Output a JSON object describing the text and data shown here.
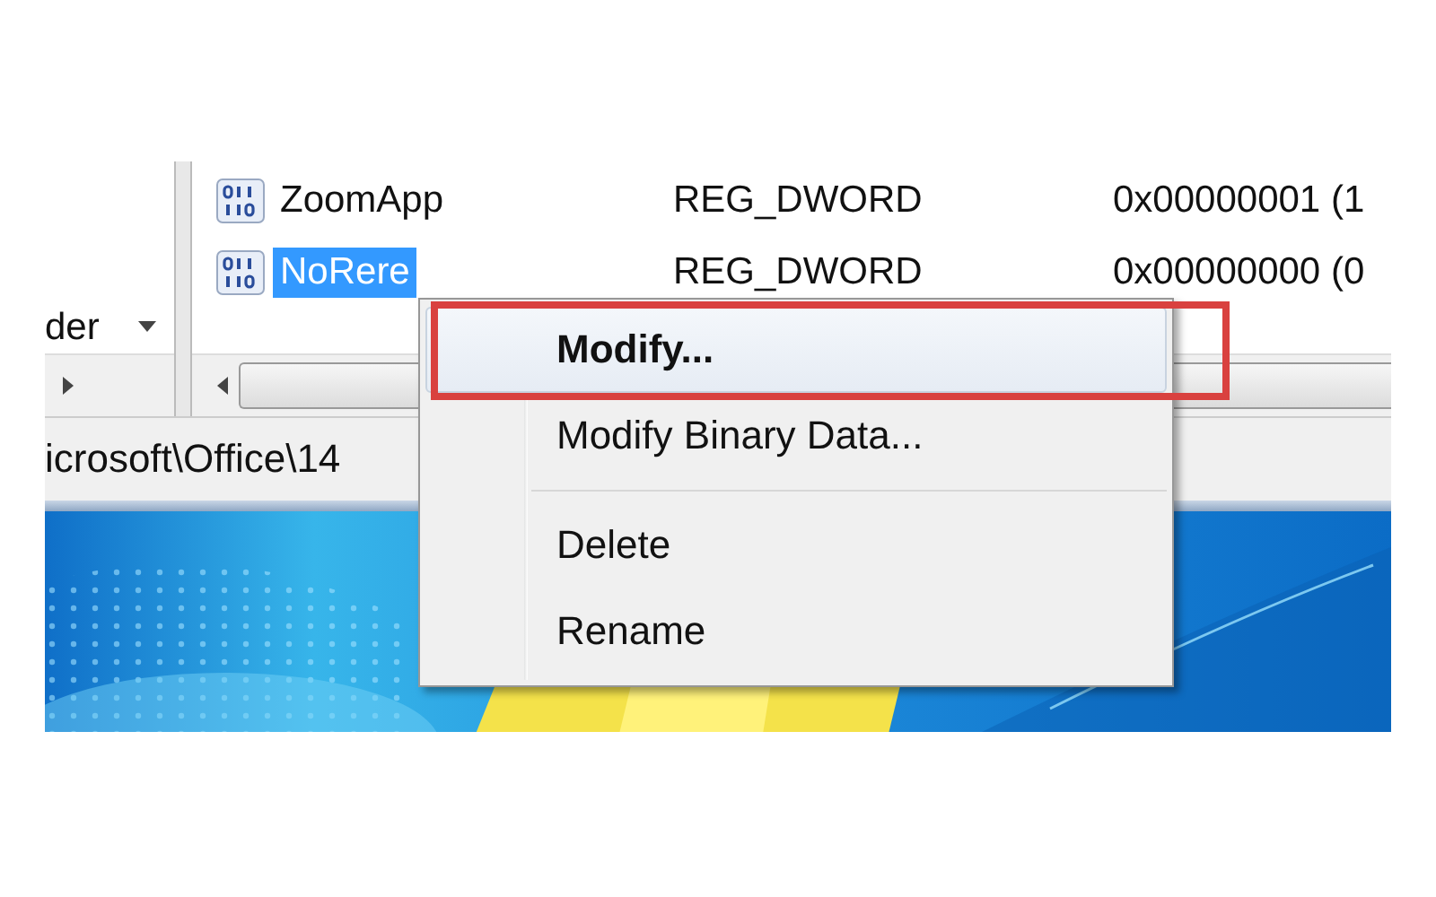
{
  "tree_pane": {
    "label": "der"
  },
  "values": {
    "rows": [
      {
        "name": "ZoomApp",
        "type": "REG_DWORD",
        "data": "0x00000001 (1",
        "selected": false
      },
      {
        "name": "NoRere",
        "type": "REG_DWORD",
        "data": "0x00000000 (0",
        "selected": true
      }
    ]
  },
  "status_bar": {
    "path": "icrosoft\\Office\\14"
  },
  "context_menu": {
    "items": [
      {
        "kind": "item",
        "label": "Modify...",
        "bold": true,
        "selected": true,
        "boxed": true
      },
      {
        "kind": "item",
        "label": "Modify Binary Data...",
        "bold": false,
        "selected": false,
        "boxed": false
      },
      {
        "kind": "separator"
      },
      {
        "kind": "item",
        "label": "Delete",
        "bold": false,
        "selected": false,
        "boxed": false
      },
      {
        "kind": "item",
        "label": "Rename",
        "bold": false,
        "selected": false,
        "boxed": false
      }
    ]
  }
}
